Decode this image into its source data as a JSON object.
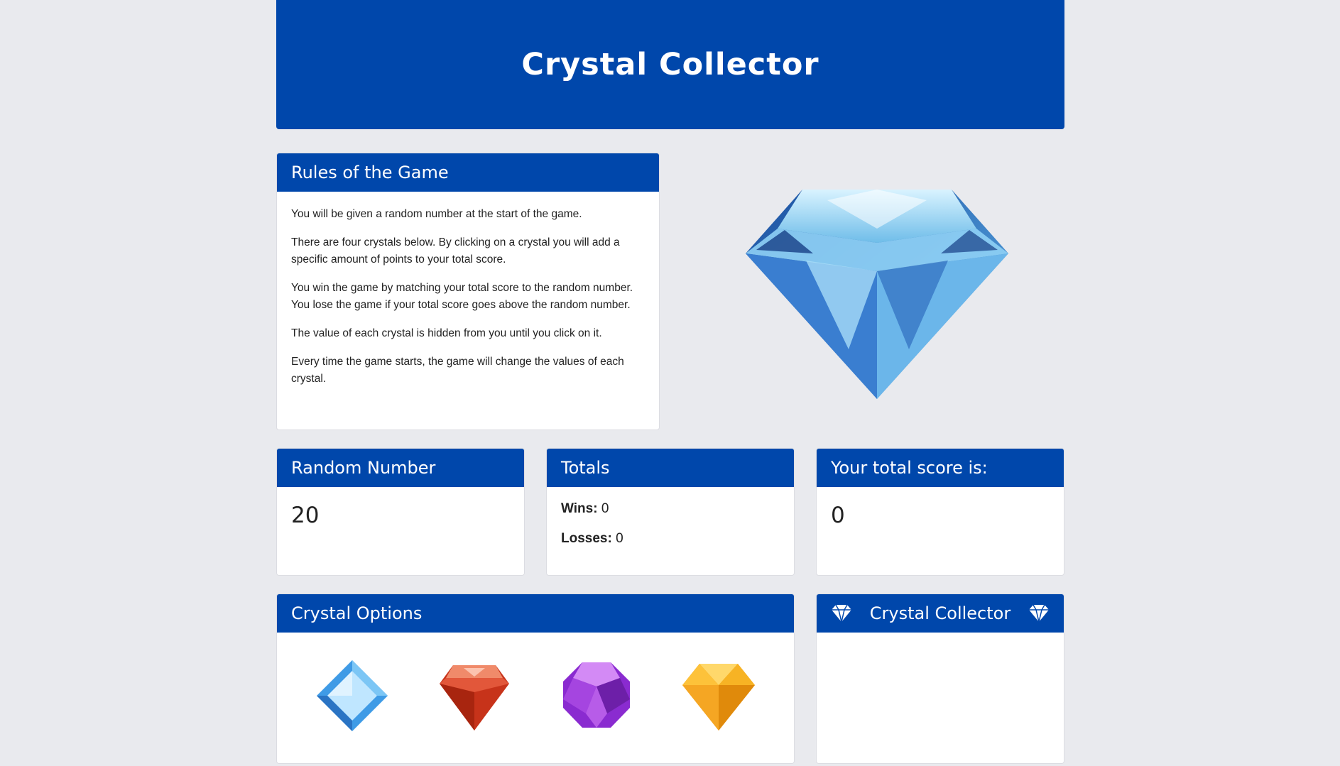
{
  "header": {
    "title": "Crystal Collector"
  },
  "rules": {
    "title": "Rules of the Game",
    "paragraphs": [
      "You will be given a random number at the start of the game.",
      "There are four crystals below. By clicking on a crystal you will add a specific amount of points to your total score.",
      "You win the game by matching your total score to the random number. You lose the game if your total score goes above the random number.",
      "The value of each crystal is hidden from you until you click on it.",
      "Every time the game starts, the game will change the values of each crystal."
    ]
  },
  "random_number": {
    "title": "Random Number",
    "value": "20"
  },
  "totals": {
    "title": "Totals",
    "wins_label": "Wins:",
    "wins": "0",
    "losses_label": "Losses:",
    "losses": "0"
  },
  "score": {
    "title": "Your total score is:",
    "value": "0"
  },
  "crystal_options": {
    "title": "Crystal Options",
    "crystals": [
      {
        "icon": "blue-crystal-icon"
      },
      {
        "icon": "red-crystal-icon"
      },
      {
        "icon": "purple-crystal-icon"
      },
      {
        "icon": "yellow-crystal-icon"
      }
    ]
  },
  "footer_card": {
    "title": "Crystal Collector",
    "icon": "diamond-icon"
  },
  "colors": {
    "brand_blue": "#0047ab",
    "background": "#e9eaee"
  }
}
